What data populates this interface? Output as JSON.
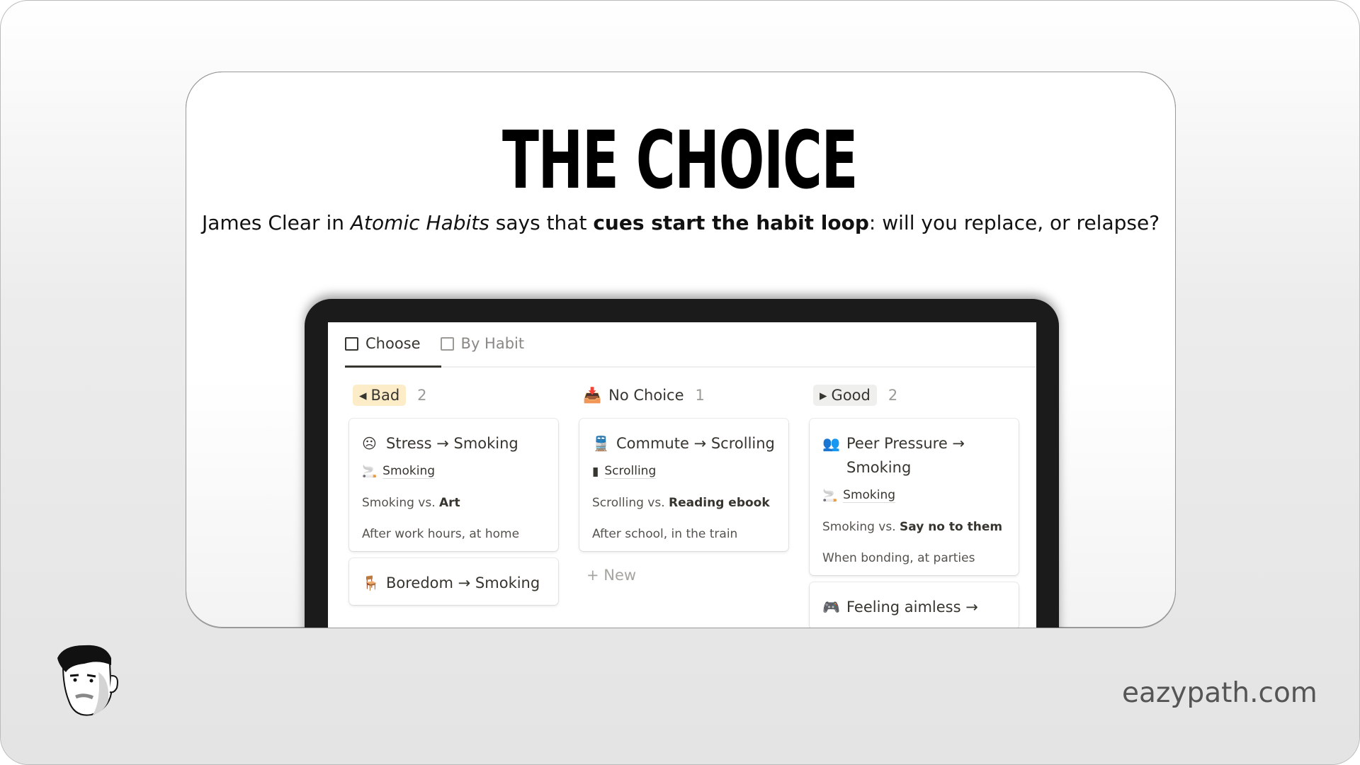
{
  "slide": {
    "title": "THE CHOICE",
    "subtitle": {
      "pre": "James Clear in ",
      "book": "Atomic Habits",
      "mid": " says that ",
      "bold": "cues start the habit loop",
      "post": ": will you replace, or relapse?"
    },
    "brand": "eazypath.com"
  },
  "tabs": [
    {
      "label": "Choose",
      "active": true
    },
    {
      "label": "By Habit",
      "active": false
    }
  ],
  "columns": [
    {
      "label": "Bad",
      "icon": "arrow-left-icon",
      "count": "2",
      "color": "#fdecc8",
      "cards": [
        {
          "icon": "frown-icon",
          "title": "Stress → Smoking",
          "habit": "Smoking",
          "habit_icon": "smoking-icon",
          "vs_pre": "Smoking vs. ",
          "vs": "Art",
          "when": "After work hours, at home"
        },
        {
          "icon": "armchair-icon",
          "title": "Boredom → Smoking"
        }
      ]
    },
    {
      "label": "No Choice",
      "icon": "inbox-icon",
      "count": "1",
      "cards": [
        {
          "icon": "train-icon",
          "title": "Commute → Scrolling",
          "habit": "Scrolling",
          "habit_icon": "phone-icon",
          "vs_pre": "Scrolling vs. ",
          "vs": "Reading ebook",
          "when": "After school, in the train"
        }
      ],
      "new_label": "New"
    },
    {
      "label": "Good",
      "icon": "arrow-right-icon",
      "count": "2",
      "color": "#efefee",
      "cards": [
        {
          "icon": "group-icon",
          "title": "Peer Pressure → Smoking",
          "habit": "Smoking",
          "habit_icon": "smoking-icon",
          "vs_pre": "Smoking vs. ",
          "vs": "Say no to them",
          "when": "When bonding, at parties"
        },
        {
          "icon": "gamepad-icon",
          "title": "Feeling aimless →"
        }
      ]
    }
  ]
}
